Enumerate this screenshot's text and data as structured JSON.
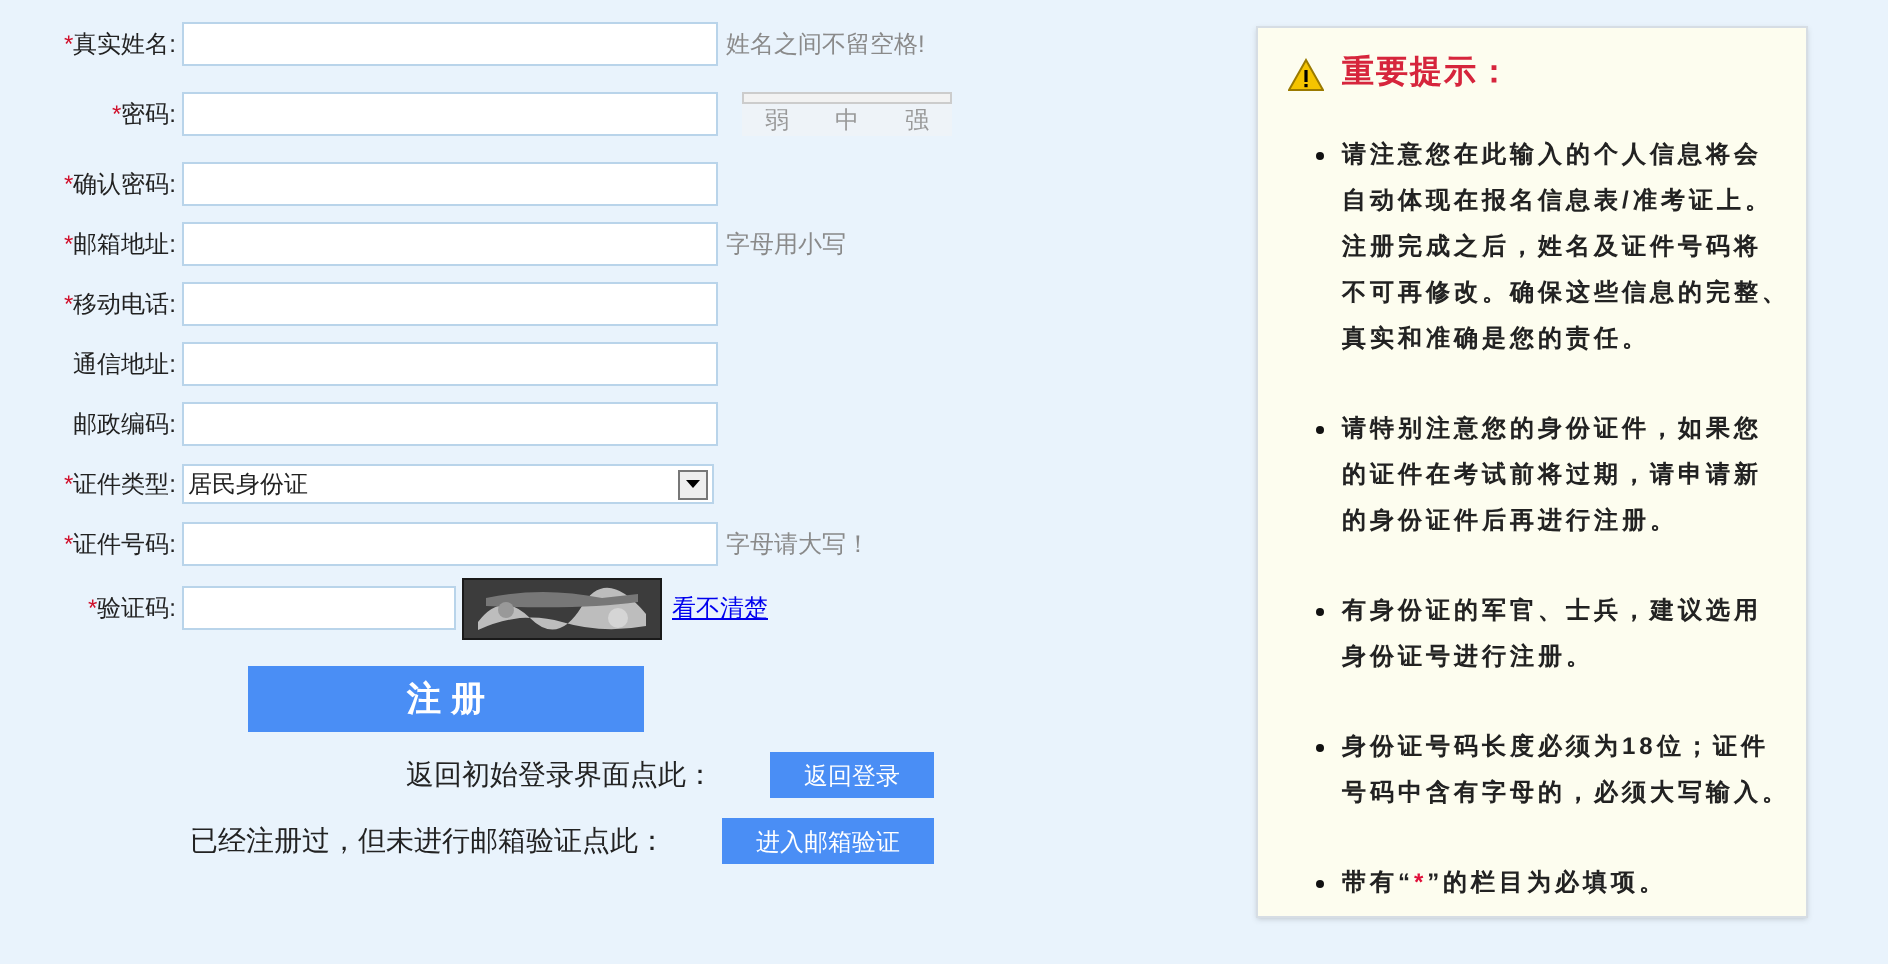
{
  "form": {
    "fields": [
      {
        "kind": "text",
        "marker": "*",
        "label": "真实姓名:",
        "hint": "姓名之间不留空格!"
      },
      {
        "kind": "password",
        "marker": "*",
        "label": "密码:",
        "strength": {
          "labels": [
            "弱",
            "中",
            "强"
          ]
        }
      },
      {
        "kind": "text",
        "marker": "*",
        "label": "确认密码:"
      },
      {
        "kind": "text",
        "marker": "*",
        "label": "邮箱地址:",
        "hint": "字母用小写"
      },
      {
        "kind": "text",
        "marker": "*",
        "label": "移动电话:"
      },
      {
        "kind": "text",
        "label": "通信地址:"
      },
      {
        "kind": "text",
        "label": "邮政编码:"
      },
      {
        "kind": "select",
        "marker": "*",
        "label": "证件类型:",
        "value": "居民身份证"
      },
      {
        "kind": "text",
        "marker": "*",
        "label": "证件号码:",
        "hint": "字母请大写！"
      },
      {
        "kind": "captcha",
        "marker": "*",
        "label": "验证码:",
        "link": "看不清楚"
      }
    ],
    "submit": "注 册",
    "actions": [
      {
        "prompt": "返回初始登录界面点此：",
        "button": "返回登录"
      },
      {
        "prompt": "已经注册过，但未进行邮箱验证点此：",
        "button": "进入邮箱验证"
      }
    ]
  },
  "notice": {
    "title": "重要提示：",
    "items": [
      {
        "lines": [
          "请注意您在此输入的个人信息将会",
          "自动体现在报名信息表/准考证上。",
          "注册完成之后，姓名及证件号码将",
          "不可再修改。确保这些信息的完整、",
          "真实和准确是您的责任。"
        ]
      },
      {
        "lines": [
          "请特别注意您的身份证件，如果您",
          "的证件在考试前将过期，请申请新",
          "的身份证件后再进行注册。"
        ]
      },
      {
        "lines": [
          "有身份证的军官、士兵，建议选用",
          "身份证号进行注册。"
        ]
      },
      {
        "lines": [
          "身份证号码长度必须为18位；证件",
          "号码中含有字母的，必须大写输入。"
        ]
      },
      {
        "before": "带有“",
        "mark": "*",
        "after": "”的栏目为必填项。"
      }
    ]
  }
}
